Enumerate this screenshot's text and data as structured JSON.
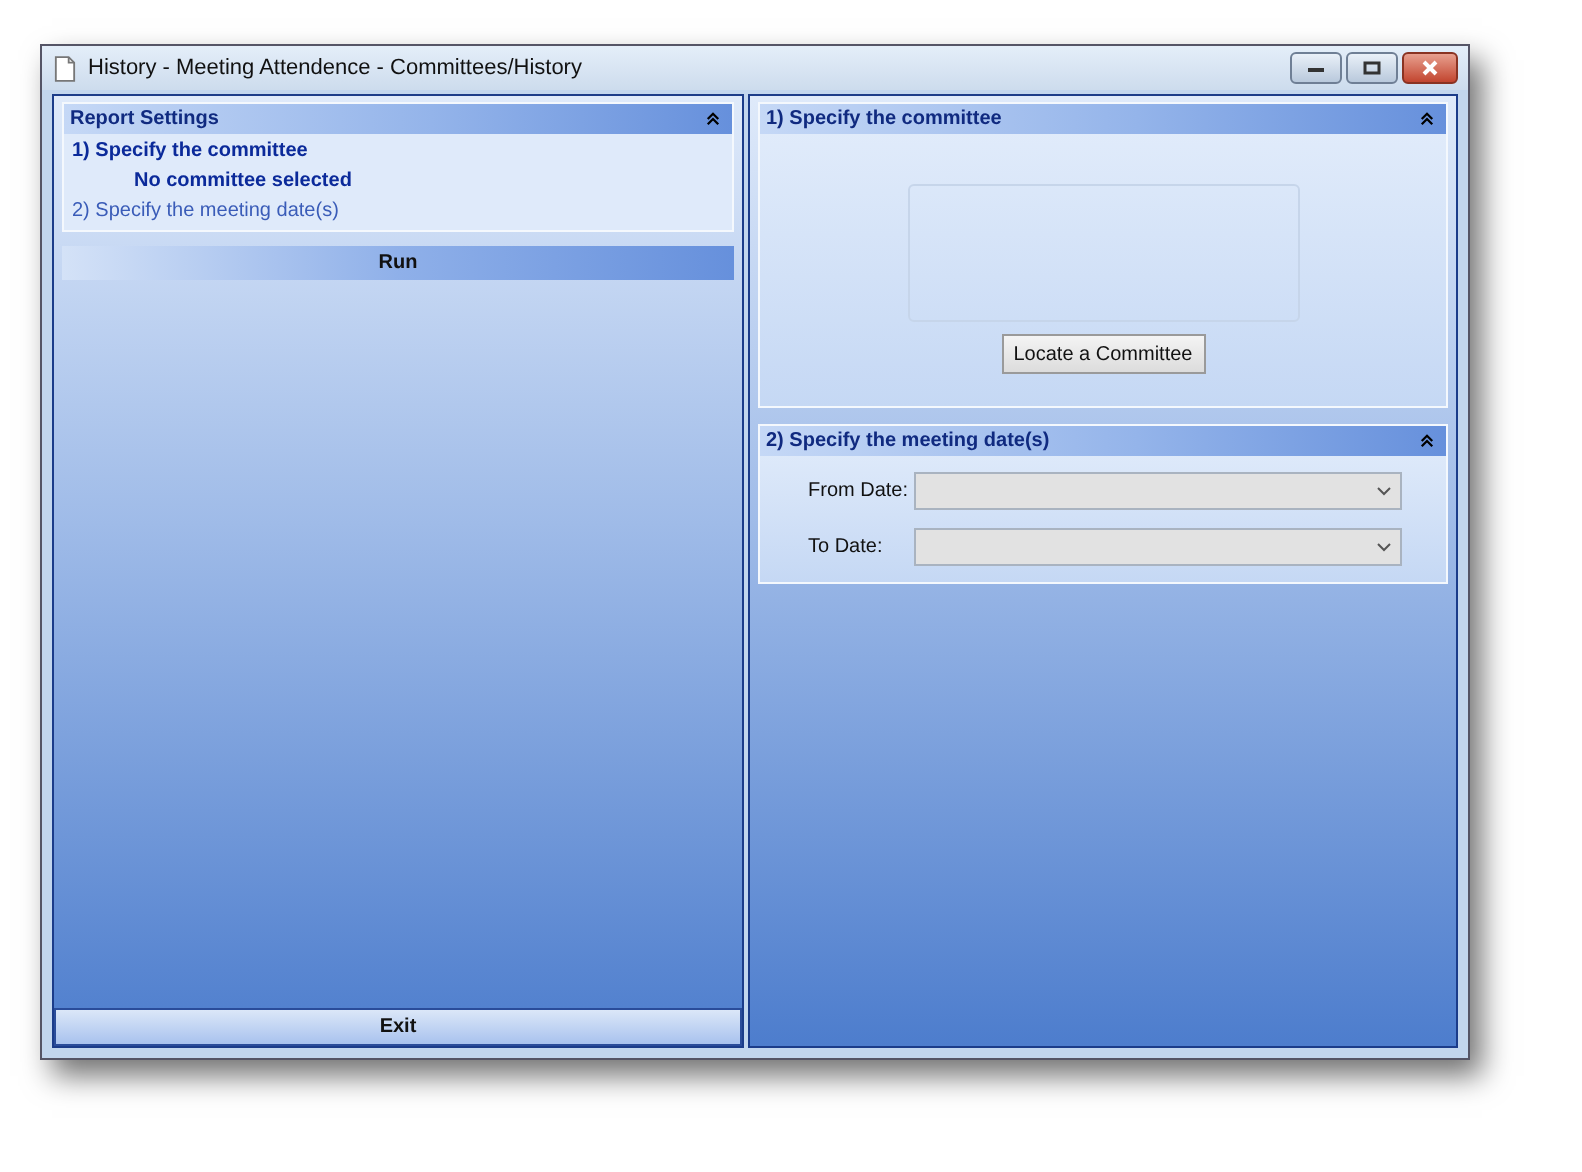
{
  "window": {
    "title": "History - Meeting Attendence - Committees/History"
  },
  "report_settings": {
    "title": "Report Settings",
    "expanded": true,
    "steps": [
      {
        "label": "1)  Specify the committee",
        "selected": true,
        "detail": "No committee selected"
      },
      {
        "label": "2)  Specify the meeting date(s)",
        "selected": false
      }
    ]
  },
  "run_button": "Run",
  "exit_button": "Exit",
  "committee_section": {
    "title": "1)  Specify the committee",
    "expanded": true,
    "button": "Locate a Committee"
  },
  "dates_section": {
    "title": "2)  Specify the meeting date(s)",
    "expanded": true,
    "fields": [
      {
        "label": "From Date:"
      },
      {
        "label": "To Date:"
      }
    ]
  }
}
